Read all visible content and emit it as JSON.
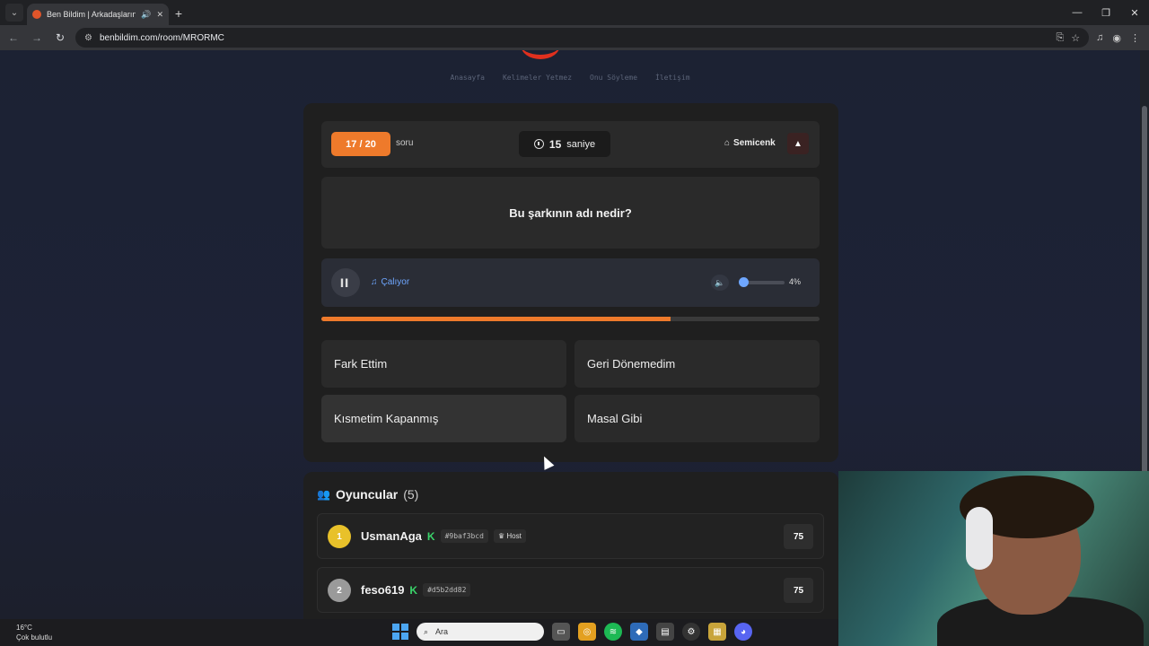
{
  "browser": {
    "tab_title": "Ben Bildim | Arkadaşlarınla",
    "url": "benbildim.com/room/MRORMC"
  },
  "nav": {
    "items": [
      "Anasayfa",
      "Kelimeler Yetmez",
      "Onu Söyleme",
      "İletişim"
    ]
  },
  "game": {
    "question_count": "17 / 20",
    "question_label": "soru",
    "timer_value": "15",
    "timer_unit": "saniye",
    "owner": "Semicenk",
    "question": "Bu şarkının adı nedir?",
    "player_status": "Çalıyor",
    "volume": "4%",
    "progress_fraction": 0.7,
    "answers": [
      "Fark Ettim",
      "Geri Dönemedim",
      "Kısmetim Kapanmış",
      "Masal Gibi"
    ]
  },
  "players": {
    "title": "Oyuncular",
    "count": "(5)",
    "list": [
      {
        "rank": "1",
        "name": "UsmanAga",
        "hash": "#9baf3bcd",
        "badge": "Host",
        "score": "75",
        "rank_color": "#e8c12a"
      },
      {
        "rank": "2",
        "name": "feso619",
        "hash": "#d5b2dd82",
        "badge": "",
        "score": "75",
        "rank_color": "#9a9a9a"
      }
    ]
  },
  "taskbar": {
    "temp": "16°C",
    "weather": "Çok bulutlu",
    "search_placeholder": "Ara"
  },
  "colors": {
    "accent": "#ee7a2b",
    "player_blue": "#6ea6ff"
  }
}
